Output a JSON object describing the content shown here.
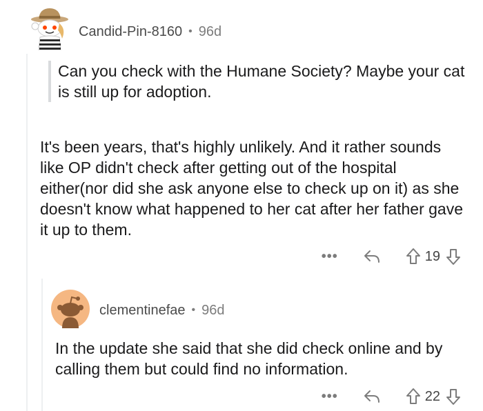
{
  "comment1": {
    "author": "Candid-Pin-8160",
    "separator": "•",
    "age": "96d",
    "quote": "Can you check with the Humane Society? Maybe your cat is still up for adoption.",
    "body": "It's been years, that's highly unlikely. And it rather sounds like OP didn't check after getting out of the hospital either(nor did she ask anyone else to check up on it) as she doesn't know what happened to her cat after her father gave it up to them.",
    "more_label": "•••",
    "score": "19"
  },
  "comment2": {
    "author": "clementinefae",
    "separator": "•",
    "age": "96d",
    "body": "In the update she said that she did check online and by calling them but could find no information.",
    "more_label": "•••",
    "score": "22"
  },
  "icons": {
    "avatar1": "snoo-with-hat-avatar",
    "avatar2": "snoo-silhouette-avatar",
    "reply": "reply-arrow-icon",
    "upvote": "upvote-arrow-icon",
    "downvote": "downvote-arrow-icon"
  },
  "colors": {
    "avatar2_bg": "#f5b782",
    "avatar2_figure": "#8b5a34",
    "meta_text": "#7c7c7c",
    "thread_line": "#edeff1"
  }
}
